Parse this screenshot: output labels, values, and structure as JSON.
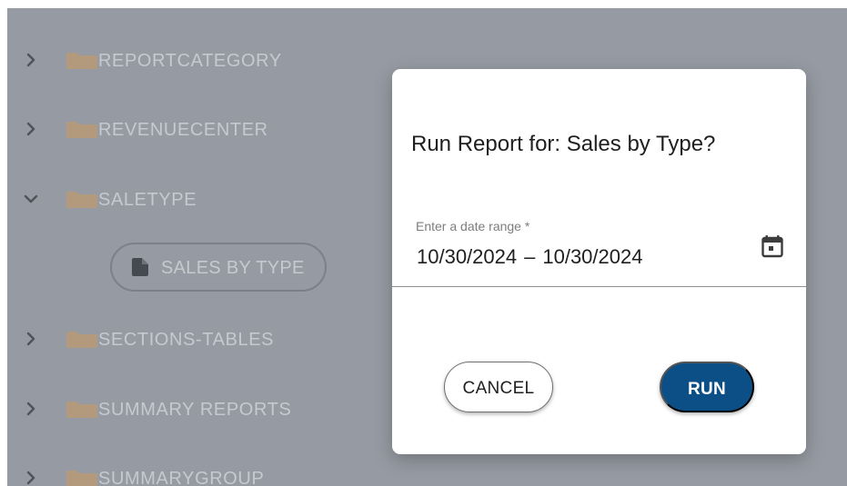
{
  "tree": {
    "items": [
      {
        "label": "REPORTCATEGORY",
        "expanded": false
      },
      {
        "label": "REVENUECENTER",
        "expanded": false
      },
      {
        "label": "SALETYPE",
        "expanded": true
      },
      {
        "label": "SECTIONS-TABLES",
        "expanded": false
      },
      {
        "label": "SUMMARY REPORTS",
        "expanded": false
      },
      {
        "label": "SUMMARYGROUP",
        "expanded": false
      }
    ],
    "report_chip": {
      "label": "SALES BY TYPE",
      "icon": "document-icon"
    }
  },
  "dialog": {
    "title": "Run Report for: Sales by Type?",
    "date_field": {
      "label": "Enter a date range *",
      "start": "10/30/2024",
      "separator": "–",
      "end": "10/30/2024",
      "icon": "calendar-icon"
    },
    "cancel_label": "CANCEL",
    "run_label": "RUN"
  },
  "colors": {
    "backdrop": "#969ba3",
    "folder": "#b39a7d",
    "run_button": "#0b4f86",
    "tree_text": "#c6c9ce"
  }
}
